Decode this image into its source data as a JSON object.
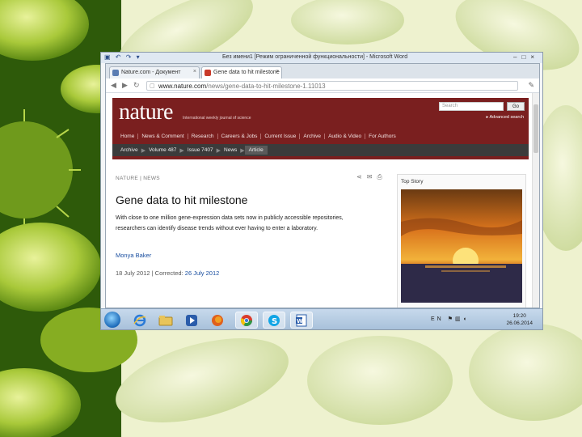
{
  "window": {
    "title": "Без имени1 [Режим ограниченной функциональности] - Microsoft Word",
    "controls": [
      "–",
      "□",
      "×"
    ]
  },
  "browser": {
    "tabs": [
      {
        "label": "Nature.com - Документ"
      },
      {
        "label": "Gene data to hit milestone"
      }
    ],
    "url_host": "www.nature.com",
    "url_path": "/news/gene-data-to-hit-milestone-1.11013"
  },
  "nature": {
    "logo": "nature",
    "tagline": "International weekly journal of science",
    "search_placeholder": "Search",
    "go_label": "Go",
    "advanced_search": "▸ Advanced search",
    "nav": [
      "Home",
      "News & Comment",
      "Research",
      "Careers & Jobs",
      "Current Issue",
      "Archive",
      "Audio & Video",
      "For Authors"
    ],
    "breadcrumb": [
      "Archive",
      "Volume 487",
      "Issue 7407",
      "News",
      "Article"
    ]
  },
  "article": {
    "section": "NATURE | NEWS",
    "headline": "Gene data to hit milestone",
    "standfirst": "With close to one million gene-expression data sets now in publicly accessible repositories, researchers can identify disease trends without ever having to enter a laboratory.",
    "author": "Monya Baker",
    "date": "18 July 2012",
    "corrected_label": "Corrected:",
    "corrected_date": "26 July 2012"
  },
  "sidebar": {
    "top_story_label": "Top Story"
  },
  "taskbar": {
    "apps": [
      "windows-start",
      "internet-explorer",
      "file-explorer",
      "media-player",
      "firefox",
      "chrome",
      "skype",
      "word"
    ],
    "tray_lang": "EN",
    "time": "19:20",
    "date": "26.06.2014"
  },
  "colors": {
    "nature_red": "#7a1f1f",
    "breadcrumb_dark": "#3b3b3b",
    "link_blue": "#1a4fa0"
  }
}
